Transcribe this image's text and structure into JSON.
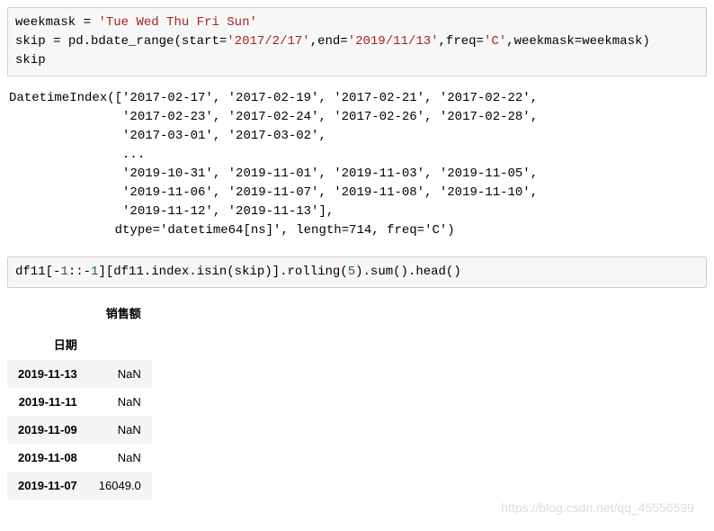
{
  "code1": {
    "line1a": "weekmask ",
    "line1b": "=",
    "line1c": " ",
    "line1d": "'Tue Wed Thu Fri Sun'",
    "line2a": "skip ",
    "line2b": "=",
    "line2c": " pd.bdate_range(start",
    "line2d": "=",
    "line2e": "'2017/2/17'",
    "line2f": ",end",
    "line2g": "=",
    "line2h": "'2019/11/13'",
    "line2i": ",freq",
    "line2j": "=",
    "line2k": "'C'",
    "line2l": ",weekmask",
    "line2m": "=",
    "line2n": "weekmask)",
    "line3": "skip"
  },
  "output1": "DatetimeIndex(['2017-02-17', '2017-02-19', '2017-02-21', '2017-02-22',\n               '2017-02-23', '2017-02-24', '2017-02-26', '2017-02-28',\n               '2017-03-01', '2017-03-02',\n               ...\n               '2019-10-31', '2019-11-01', '2019-11-03', '2019-11-05',\n               '2019-11-06', '2019-11-07', '2019-11-08', '2019-11-10',\n               '2019-11-12', '2019-11-13'],\n              dtype='datetime64[ns]', length=714, freq='C')",
  "code2": {
    "a": "df11[",
    "b": "-",
    "c": "1",
    "d": "::",
    "e": "-",
    "f": "1",
    "g": "][df11.index.isin(skip)].rolling(",
    "h": "5",
    "i": ").sum().head()"
  },
  "table": {
    "col_header": "销售额",
    "index_label": "日期",
    "rows": [
      {
        "date": "2019-11-13",
        "value": "NaN"
      },
      {
        "date": "2019-11-11",
        "value": "NaN"
      },
      {
        "date": "2019-11-09",
        "value": "NaN"
      },
      {
        "date": "2019-11-08",
        "value": "NaN"
      },
      {
        "date": "2019-11-07",
        "value": "16049.0"
      }
    ]
  },
  "watermark": "https://blog.csdn.net/qq_45556599"
}
